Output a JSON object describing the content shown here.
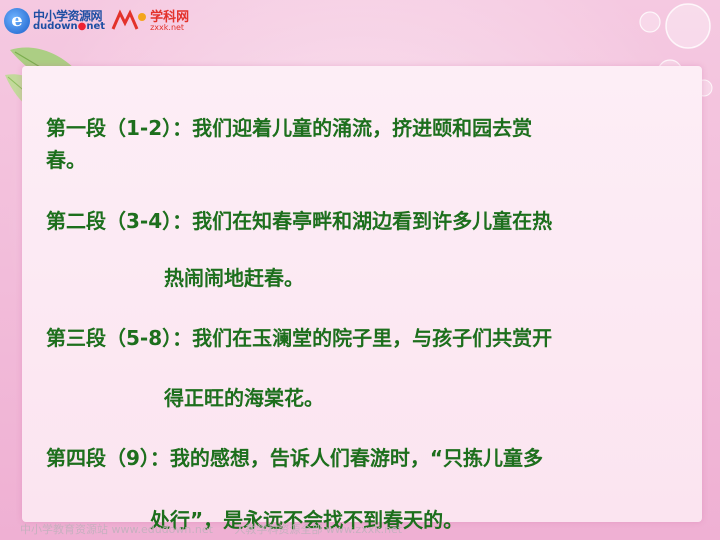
{
  "logos": {
    "logo_a_cn": "中小学资源网",
    "logo_a_en": "dudown",
    "logo_a_en_suffix": "net",
    "logo_b_cn": "学科网",
    "logo_b_en": "zxxk.net"
  },
  "lines": [
    "第一段（1-2）：我们迎着儿童的涌流，挤进颐和园去赏",
    "春。",
    "第二段（3-4）：我们在知春亭畔和湖边看到许多儿童在热",
    "热闹闹地赶春。",
    "第三段（5-8）：我们在玉澜堂的院子里，与孩子们共赏开",
    "得正旺的海棠花。",
    "第四段（9）：我的感想，告诉人们春游时，“只拣儿童多",
    "处行”，是永远不会找不到春天的。"
  ],
  "footer": {
    "left": "中小学教育资源站 www.edudown.net",
    "right": "人教学科资源全部 www.zxxk.net"
  },
  "colors": {
    "text": "#1d6f1d",
    "panel": "#fdeef6",
    "frame": "#f0aed2"
  }
}
